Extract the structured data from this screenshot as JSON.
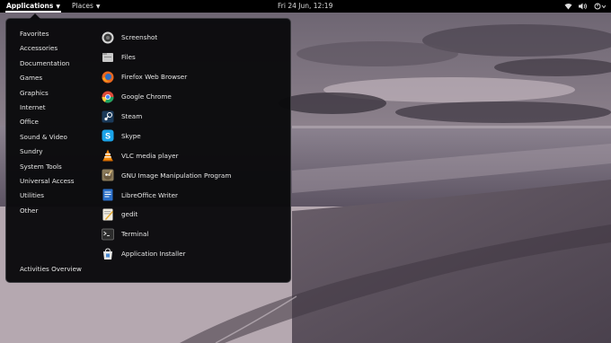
{
  "topbar": {
    "applications_label": "Applications",
    "places_label": "Places",
    "clock": "Fri 24 Jun, 12:19",
    "tray_icons": [
      "network-wifi-icon",
      "volume-icon",
      "power-icon"
    ]
  },
  "menu": {
    "categories": [
      {
        "label": "Favorites"
      },
      {
        "label": "Accessories"
      },
      {
        "label": "Documentation"
      },
      {
        "label": "Games"
      },
      {
        "label": "Graphics"
      },
      {
        "label": "Internet"
      },
      {
        "label": "Office"
      },
      {
        "label": "Sound & Video"
      },
      {
        "label": "Sundry"
      },
      {
        "label": "System Tools"
      },
      {
        "label": "Universal Access"
      },
      {
        "label": "Utilities"
      },
      {
        "label": "Other"
      }
    ],
    "activities_label": "Activities Overview",
    "apps": [
      {
        "label": "Screenshot",
        "icon": "screenshot-icon"
      },
      {
        "label": "Files",
        "icon": "files-icon"
      },
      {
        "label": "Firefox Web Browser",
        "icon": "firefox-icon"
      },
      {
        "label": "Google Chrome",
        "icon": "chrome-icon"
      },
      {
        "label": "Steam",
        "icon": "steam-icon"
      },
      {
        "label": "Skype",
        "icon": "skype-icon"
      },
      {
        "label": "VLC media player",
        "icon": "vlc-icon"
      },
      {
        "label": "GNU Image Manipulation Program",
        "icon": "gimp-icon"
      },
      {
        "label": "LibreOffice Writer",
        "icon": "libreoffice-writer-icon"
      },
      {
        "label": "gedit",
        "icon": "gedit-icon"
      },
      {
        "label": "Terminal",
        "icon": "terminal-icon"
      },
      {
        "label": "Application Installer",
        "icon": "application-installer-icon"
      }
    ]
  },
  "colors": {
    "topbar_bg": "#000000",
    "menu_bg": "#0a0a0c",
    "text": "#e6e6e6"
  }
}
